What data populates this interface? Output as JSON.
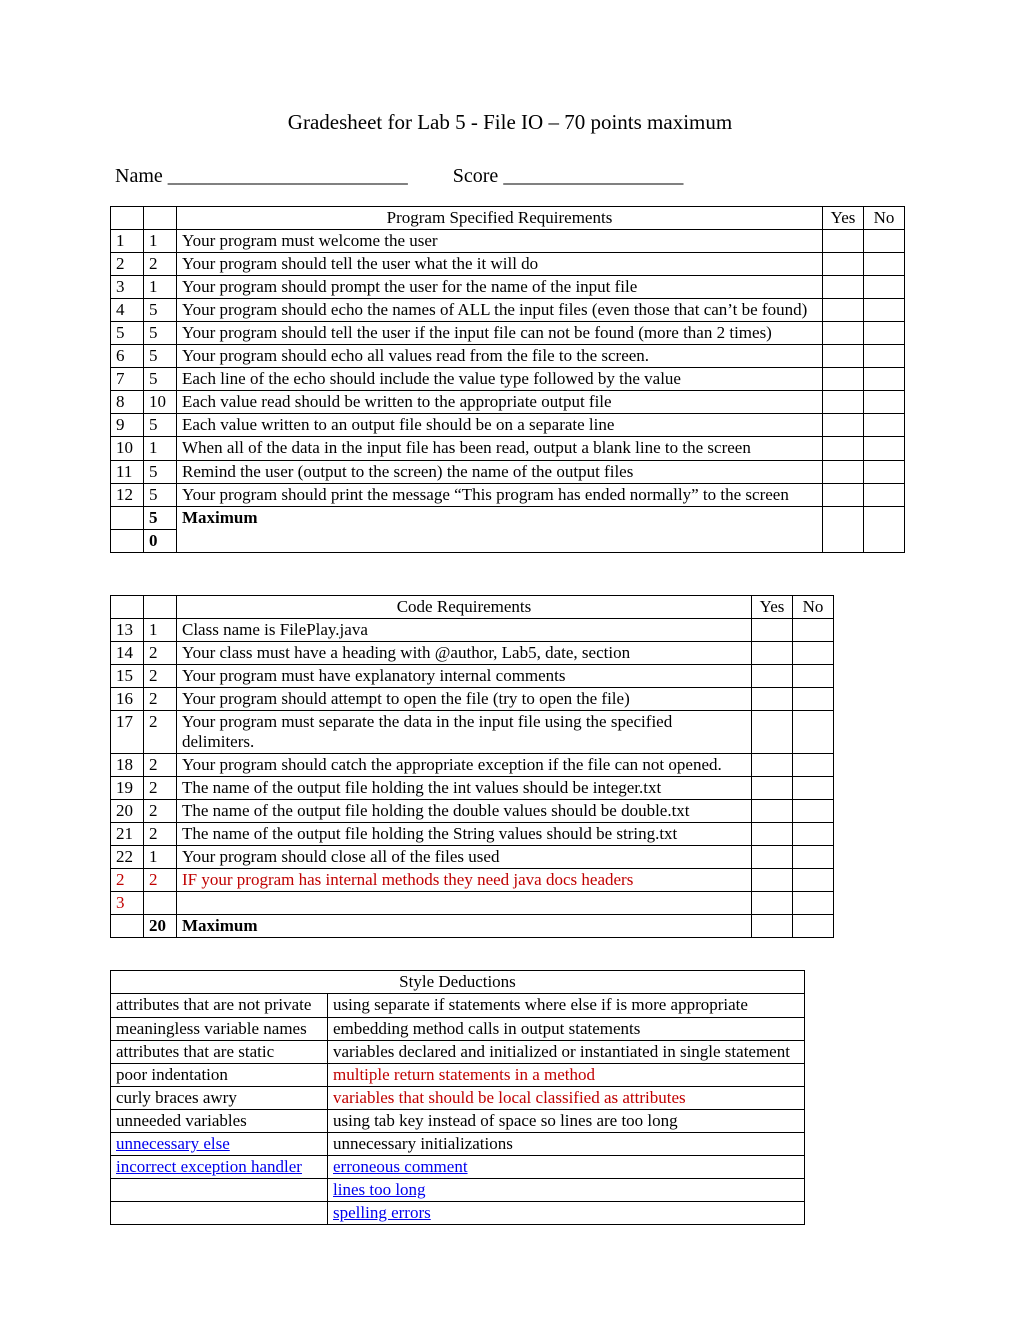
{
  "title": "Gradesheet for Lab 5 -  File IO – 70 points maximum",
  "name_label": "Name ",
  "name_blank": "________________________",
  "score_label": "Score ",
  "score_blank": "__________________",
  "table1": {
    "header_desc": "Program Specified Requirements",
    "yes": "Yes",
    "no": "No",
    "rows": [
      {
        "n": "1",
        "p": "1",
        "d": "Your program must welcome the user"
      },
      {
        "n": "2",
        "p": "2",
        "d": "Your program should tell the user what the it will do"
      },
      {
        "n": "3",
        "p": "1",
        "d": "Your program should prompt the user for the name of the input file"
      },
      {
        "n": "4",
        "p": "5",
        "d": "Your program should echo the names of ALL the input files (even those that can’t be found)"
      },
      {
        "n": "5",
        "p": "5",
        "d": "Your program should tell the user if the input file can not be found (more than 2 times)"
      },
      {
        "n": "6",
        "p": "5",
        "d": "Your program should echo all values read from the file to the screen."
      },
      {
        "n": "7",
        "p": "5",
        "d": "Each line of the echo should include the value type followed by the value"
      },
      {
        "n": "8",
        "p": "10",
        "d": "Each value read should be written to the appropriate output file"
      },
      {
        "n": "9",
        "p": "5",
        "d": "Each value written to an output file should be on a separate line"
      },
      {
        "n": "10",
        "p": "1",
        "d": "When all of the data in the input file has been read, output a blank line to the screen"
      },
      {
        "n": "11",
        "p": "5",
        "d": "Remind the user (output to the screen) the name of the output files"
      },
      {
        "n": "12",
        "p": "5",
        "d": "Your program should print the message “This program has ended normally” to the screen"
      }
    ],
    "max_p1": "5",
    "max_p2": "0",
    "max_label": "Maximum"
  },
  "table2": {
    "header_desc": "Code Requirements",
    "yes": "Yes",
    "no": "No",
    "rows": [
      {
        "n": "13",
        "p": "1",
        "d": "Class name is FilePlay.java",
        "red": false
      },
      {
        "n": "14",
        "p": "2",
        "d": "Your class must have a heading with @author, Lab5, date, section",
        "red": false
      },
      {
        "n": "15",
        "p": "2",
        "d": "Your program must  have explanatory internal comments",
        "red": false
      },
      {
        "n": "16",
        "p": "2",
        "d": "Your program should attempt to open the file (try to open the file)",
        "red": false
      },
      {
        "n": "17",
        "p": "2",
        "d": "Your program must separate the data in the input file using the specified delimiters.",
        "red": false
      },
      {
        "n": "18",
        "p": "2",
        "d": "Your program should catch the appropriate exception if the file can not opened.",
        "red": false
      },
      {
        "n": "19",
        "p": "2",
        "d": "The name of the output file holding the int values should be integer.txt",
        "red": false
      },
      {
        "n": "20",
        "p": "2",
        "d": "The name of the output file holding the double values should be double.txt",
        "red": false
      },
      {
        "n": "21",
        "p": "2",
        "d": "The name of the output file holding the String values should be string.txt",
        "red": false
      },
      {
        "n": "22",
        "p": "1",
        "d": "Your program should close all of the files used",
        "red": false
      },
      {
        "n": "2",
        "p": "2",
        "d": "IF your program has internal methods they need java docs headers",
        "red": true
      }
    ],
    "extra_n": "3",
    "max_p": "20",
    "max_label": "Maximum"
  },
  "table3": {
    "header": "Style Deductions",
    "rows": [
      {
        "l": "attributes that are not private",
        "r": "using separate if statements where else if is more appropriate",
        "ll": false,
        "rl": false,
        "rr": false
      },
      {
        "l": "meaningless variable names",
        "r": "embedding method calls in output statements",
        "ll": false,
        "rl": false,
        "rr": false
      },
      {
        "l": "attributes that are static",
        "r": "variables declared and initialized or instantiated in single statement",
        "ll": false,
        "rl": false,
        "rr": false
      },
      {
        "l": "poor indentation",
        "r": "multiple return statements in a method",
        "ll": false,
        "rl": false,
        "rr": true
      },
      {
        "l": "curly braces awry",
        "r": "variables that should be local classified as attributes",
        "ll": false,
        "rl": false,
        "rr": true
      },
      {
        "l": "unneeded variables",
        "r": "using tab key instead of space so lines are too long",
        "ll": false,
        "rl": false,
        "rr": false
      },
      {
        "l": "unnecessary else",
        "r": "unnecessary initializations",
        "ll": true,
        "rl": false,
        "rr": false
      },
      {
        "l": "incorrect exception handler",
        "r": "erroneous comment",
        "ll": true,
        "rl": true,
        "rr": false
      },
      {
        "l": "",
        "r": "lines too long",
        "ll": false,
        "rl": true,
        "rr": false
      },
      {
        "l": "",
        "r": "spelling errors",
        "ll": false,
        "rl": true,
        "rr": false
      }
    ]
  }
}
